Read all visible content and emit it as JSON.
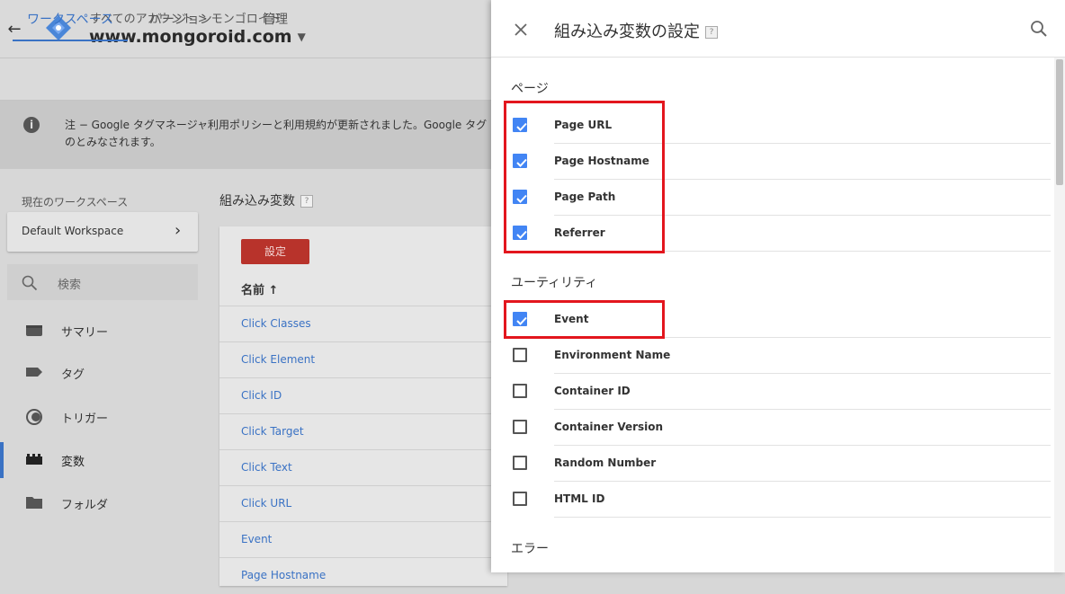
{
  "header": {
    "breadcrumb": "すべてのアカウント > モンゴロイド",
    "container_name": "www.mongoroid.com"
  },
  "nav_tabs": [
    "ワークスペース",
    "バージョン",
    "管理"
  ],
  "notice": {
    "line1": "注 − Google タグマネージャ利用ポリシーと利用規約が更新されました。Google タグマネージャを引き続きご利用になる場合、更新されたポリシーに同意したも",
    "line2": "のとみなされます。"
  },
  "workspace": {
    "label": "現在のワークスペース",
    "name": "Default Workspace"
  },
  "sidebar": {
    "search": "検索",
    "items": [
      "サマリー",
      "タグ",
      "トリガー",
      "変数",
      "フォルダ"
    ]
  },
  "content": {
    "title": "組み込み変数",
    "config_button": "設定",
    "column_name": "名前 ↑",
    "rows": [
      "Click Classes",
      "Click Element",
      "Click ID",
      "Click Target",
      "Click Text",
      "Click URL",
      "Event",
      "Page Hostname"
    ]
  },
  "panel": {
    "title": "組み込み変数の設定",
    "sections": [
      {
        "heading": "ページ",
        "items": [
          {
            "label": "Page URL",
            "checked": true
          },
          {
            "label": "Page Hostname",
            "checked": true
          },
          {
            "label": "Page Path",
            "checked": true
          },
          {
            "label": "Referrer",
            "checked": true
          }
        ]
      },
      {
        "heading": "ユーティリティ",
        "items": [
          {
            "label": "Event",
            "checked": true
          },
          {
            "label": "Environment Name",
            "checked": false
          },
          {
            "label": "Container ID",
            "checked": false
          },
          {
            "label": "Container Version",
            "checked": false
          },
          {
            "label": "Random Number",
            "checked": false
          },
          {
            "label": "HTML ID",
            "checked": false
          }
        ]
      },
      {
        "heading": "エラー",
        "items": []
      }
    ]
  },
  "colors": {
    "accent": "#4285f4",
    "link": "#3a72c4",
    "button_red": "#b8332b",
    "highlight_box": "#e3161e"
  }
}
